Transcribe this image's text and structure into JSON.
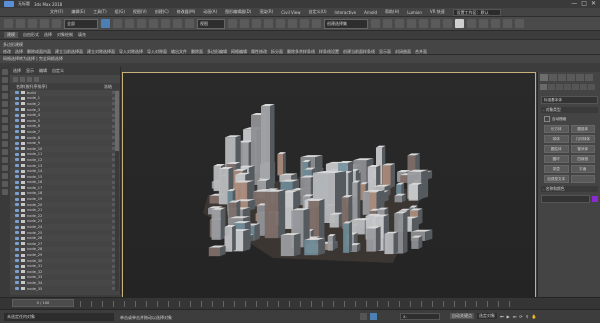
{
  "titlebar": {
    "filename": "无标题",
    "app": "3ds Max 2018",
    "controls": [
      "—",
      "□",
      "✕"
    ]
  },
  "menubar": {
    "items": [
      "文件(F)",
      "编辑(E)",
      "工具(T)",
      "组(G)",
      "视图(V)",
      "创建(C)",
      "修改器(M)",
      "动画(A)",
      "图形编辑器(D)",
      "渲染(R)",
      "Civil View",
      "自定义(U)",
      "Interactive",
      "Arnold",
      "帮助(H)",
      "Lumion",
      "VR 快速"
    ],
    "workspace": "设置工作区：默认"
  },
  "maintoolbar": {
    "selection_filter": "全部",
    "view_dropdown": "视图",
    "named_sel": "创建选择集"
  },
  "ribbon": {
    "tabs": [
      "建模",
      "自由形式",
      "选择",
      "对象绘制",
      "填充"
    ],
    "line1": "多边形建模",
    "commands": [
      "修改",
      "选择",
      "删除成面内面",
      "建立当前选择面",
      "建立对称选择面",
      "导入对称选择",
      "导入对称面",
      "输出文件",
      "删除面",
      "多边形编辑",
      "网格编辑",
      "属性修改",
      "拆分面",
      "删除多余样条线",
      "样条线设置",
      "创建当前面样条线",
      "显示面",
      "封闭曲面",
      "合并面"
    ],
    "line2": "网格选择转为选择 | 完全网格选择"
  },
  "scene_explorer": {
    "tabs": [
      "选择",
      "显示",
      "编辑",
      "自定义"
    ],
    "column_name": "名称(按升序排序)",
    "column_frozen": "冻结",
    "nodes": [
      "build",
      "node_1",
      "node_2",
      "node_3",
      "node_4",
      "node_5",
      "node_6",
      "node_7",
      "node_8",
      "node_9",
      "node_10",
      "node_11",
      "node_12",
      "node_13",
      "node_14",
      "node_15",
      "node_16",
      "node_17",
      "node_18",
      "node_19",
      "node_20",
      "node_21",
      "node_22",
      "node_23",
      "node_24",
      "node_25",
      "node_26",
      "node_27",
      "node_28",
      "node_29",
      "node_30",
      "node_31",
      "node_32",
      "node_33",
      "node_34",
      "node_35"
    ]
  },
  "viewport": {
    "label": "[+] [透视] [标准] [默认明暗处理]"
  },
  "command_panel": {
    "category": "标准基本体",
    "object_type_header": "- 对象类型",
    "auto_grid": "自动栅格",
    "buttons": [
      "长方体",
      "圆锥体",
      "球体",
      "几何球体",
      "圆柱体",
      "管状体",
      "圆环",
      "四棱锥",
      "茶壶",
      "平面",
      "加强型文本",
      ""
    ],
    "name_color_header": "- 名称和颜色",
    "object_color": "#8a2bd0"
  },
  "timeline": {
    "frame": "0 / 100"
  },
  "statusbar": {
    "prompt": "单击或单击并拖动以选择对象",
    "selected": "未选定任何对象",
    "coord": "X: ",
    "autokey": "自动关键点",
    "selected_set": "选定对象"
  }
}
